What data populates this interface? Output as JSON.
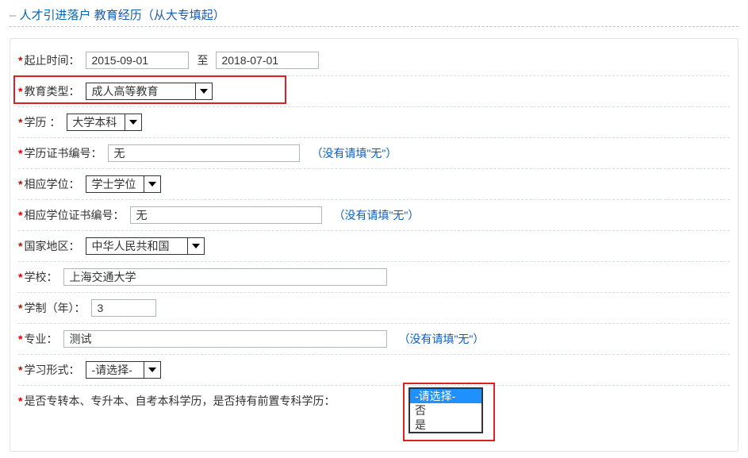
{
  "title": {
    "main": "人才引进落户",
    "sub": "教育经历（从大专填起）"
  },
  "rows": {
    "dateRange": {
      "label": "起止时间：",
      "start": "2015-09-01",
      "separator": "至",
      "end": "2018-07-01"
    },
    "eduType": {
      "label": "教育类型：",
      "value": "成人高等教育"
    },
    "degree": {
      "label": "学历 ：",
      "value": "大学本科"
    },
    "certNo": {
      "label": "学历证书编号：",
      "value": "无",
      "hint": "（没有请填\"无\"）"
    },
    "academicDegree": {
      "label": "相应学位：",
      "value": "学士学位"
    },
    "degreeCertNo": {
      "label": "相应学位证书编号：",
      "value": "无",
      "hint": "（没有请填\"无\"）"
    },
    "country": {
      "label": "国家地区：",
      "value": "中华人民共和国"
    },
    "school": {
      "label": "学校：",
      "value": "上海交通大学"
    },
    "years": {
      "label": "学制（年）：",
      "value": "3"
    },
    "major": {
      "label": "专业：",
      "value": "测试",
      "hint": "（没有请填\"无\"）"
    },
    "studyForm": {
      "label": "学习形式：",
      "value": "-请选择-"
    },
    "preDiploma": {
      "label": "是否专转本、专升本、自考本科学历，是否持有前置专科学历：",
      "options": [
        "-请选择-",
        "否",
        "是"
      ],
      "selected": "-请选择-"
    }
  }
}
